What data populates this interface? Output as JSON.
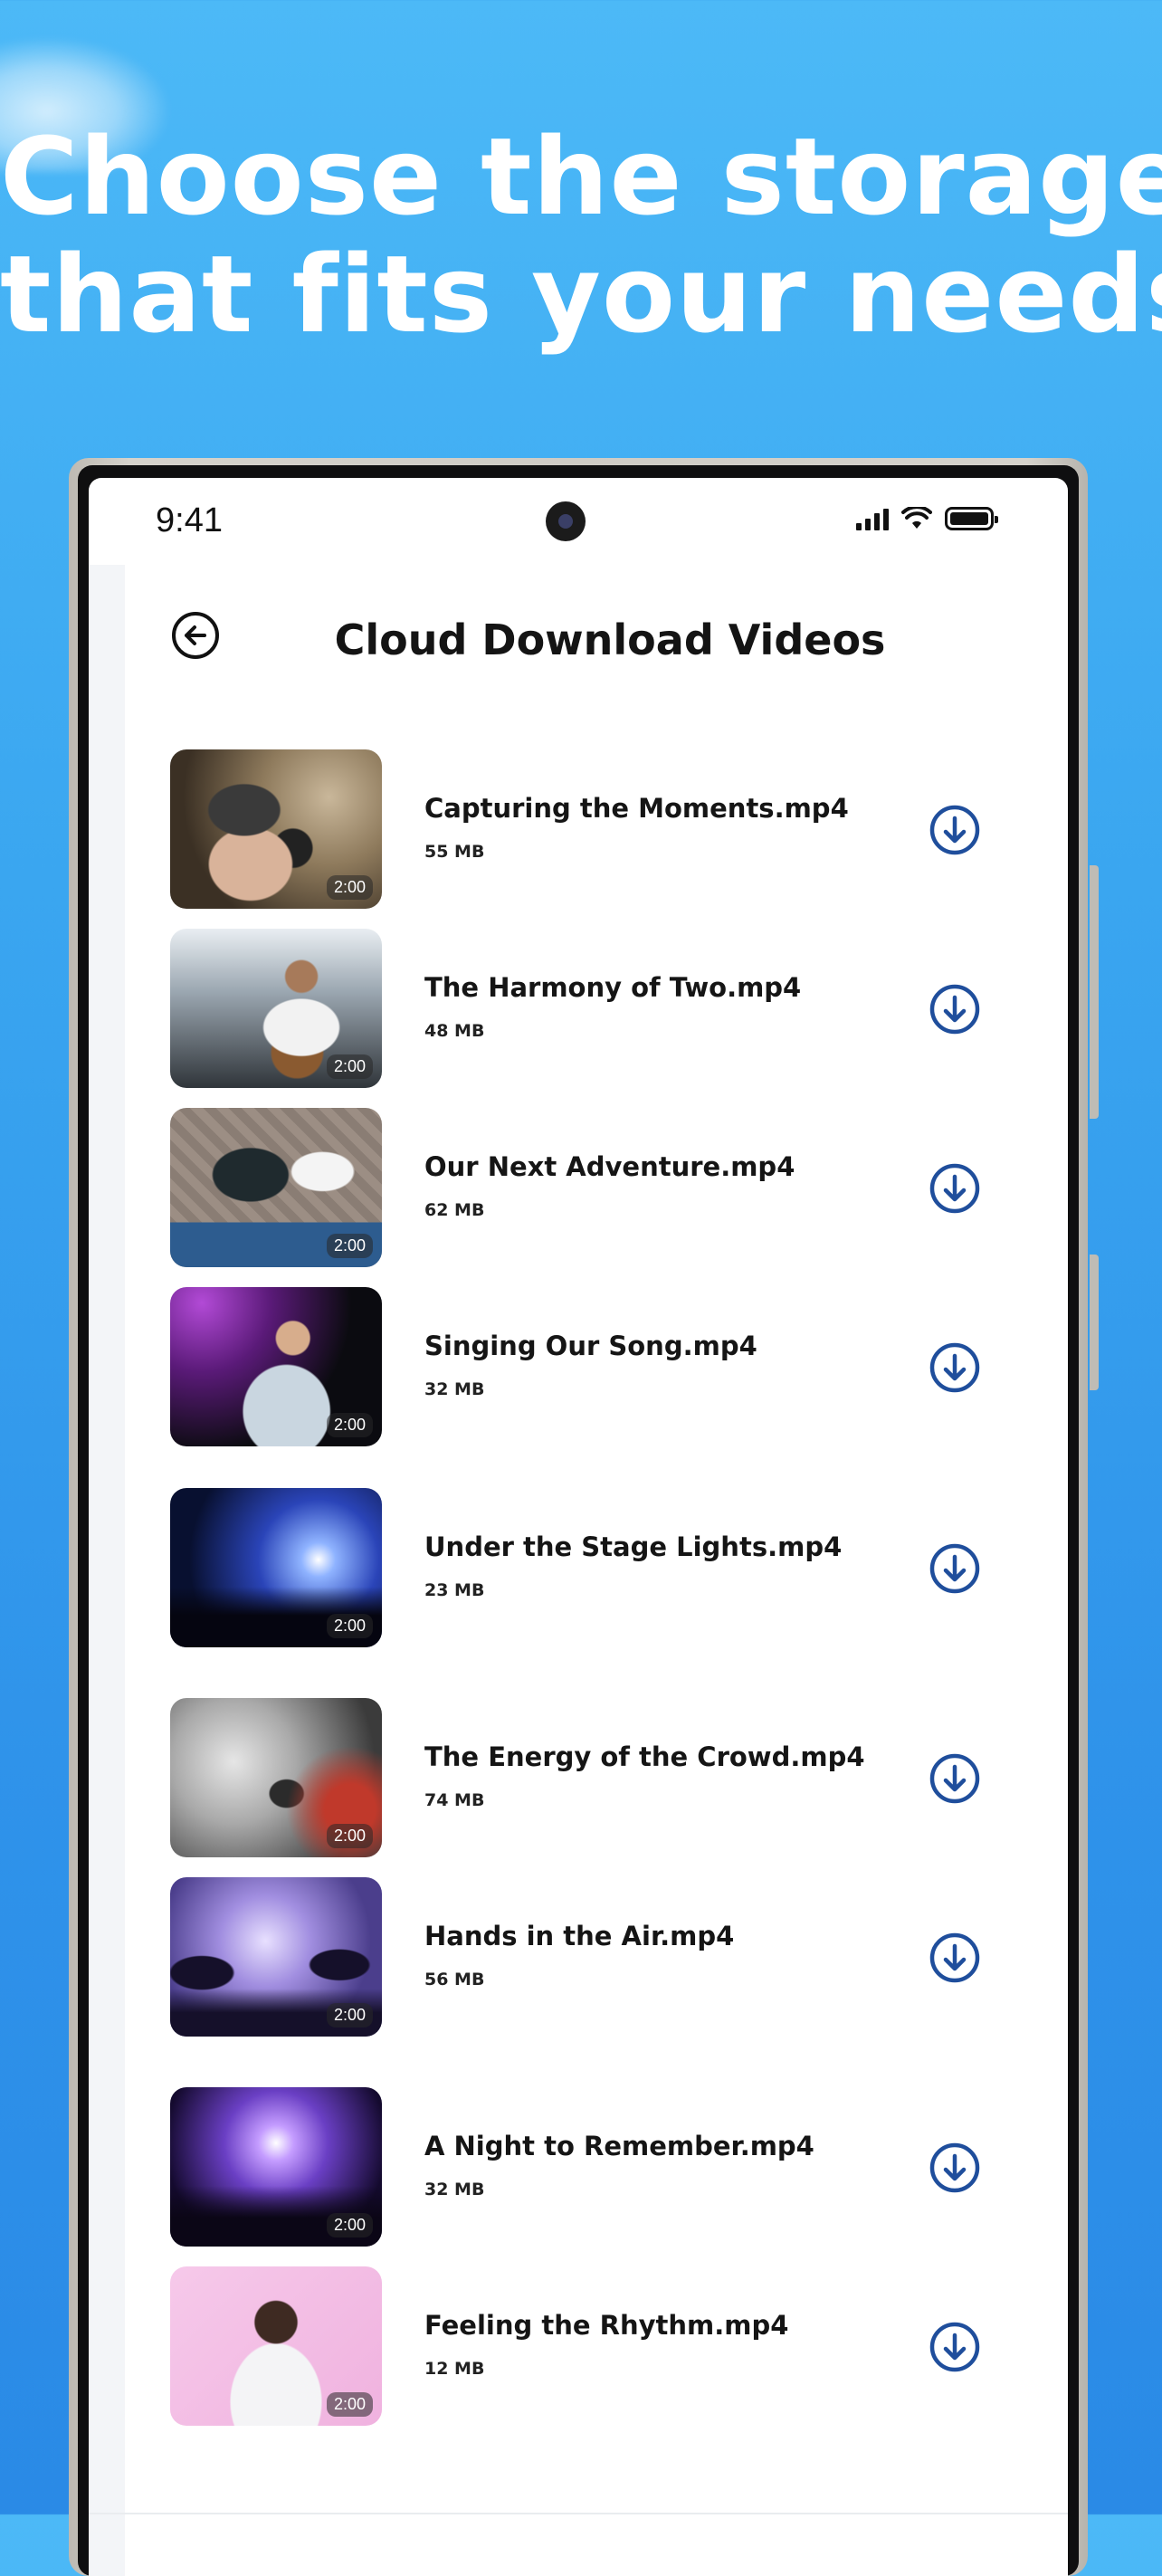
{
  "headline": {
    "line1": "Choose the storage",
    "line2": "that fits your needs"
  },
  "status_bar": {
    "time": "9:41"
  },
  "screen": {
    "title": "Cloud Download Videos"
  },
  "colors": {
    "accent": "#1f4e9c",
    "background_top": "#4cb9f7",
    "background_bottom": "#2a8ae6"
  },
  "videos": [
    {
      "name": "Capturing the Moments.mp4",
      "size": "55 MB",
      "duration": "2:00",
      "thumb_icon": "photographer-thumbnail"
    },
    {
      "name": "The Harmony of Two.mp4",
      "size": "48 MB",
      "duration": "2:00",
      "thumb_icon": "guitarist-thumbnail"
    },
    {
      "name": "Our Next Adventure.mp4",
      "size": "62 MB",
      "duration": "2:00",
      "thumb_icon": "polaroid-thumbnail"
    },
    {
      "name": "Singing Our Song.mp4",
      "size": "32 MB",
      "duration": "2:00",
      "thumb_icon": "singer-thumbnail"
    },
    {
      "name": "Under the Stage Lights.mp4",
      "size": "23 MB",
      "duration": "2:00",
      "thumb_icon": "stage-lights-thumbnail"
    },
    {
      "name": "The Energy of the Crowd.mp4",
      "size": "74 MB",
      "duration": "2:00",
      "thumb_icon": "crowd-smoke-thumbnail"
    },
    {
      "name": "Hands in the Air.mp4",
      "size": "56 MB",
      "duration": "2:00",
      "thumb_icon": "hands-up-thumbnail"
    },
    {
      "name": "A Night to Remember.mp4",
      "size": "32 MB",
      "duration": "2:00",
      "thumb_icon": "concert-night-thumbnail"
    },
    {
      "name": "Feeling the Rhythm.mp4",
      "size": "12 MB",
      "duration": "2:00",
      "thumb_icon": "headphones-thumbnail"
    }
  ]
}
